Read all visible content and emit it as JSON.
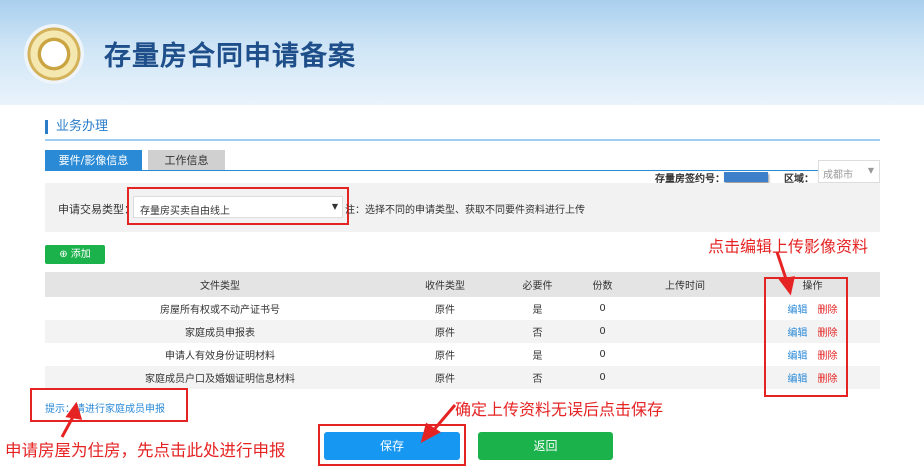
{
  "header": {
    "title": "存量房合同申请备案"
  },
  "section": {
    "title": "业务办理"
  },
  "tabs": [
    {
      "label": "要件/影像信息",
      "active": true
    },
    {
      "label": "工作信息",
      "active": false
    }
  ],
  "contract": {
    "label": "存量房签约号：",
    "region_label": "区域：",
    "region_value": "成都市"
  },
  "filter": {
    "label": "申请交易类型：",
    "value": "存量房买卖自由线上",
    "note": "注：选择不同的申请类型、获取不同要件资料进行上传"
  },
  "add_button": "添加",
  "table": {
    "headers": [
      "文件类型",
      "收件类型",
      "必要件",
      "份数",
      "上传时间",
      "操作"
    ],
    "rows": [
      {
        "type": "房屋所有权或不动产证书号",
        "receive": "原件",
        "required": "是",
        "count": "0",
        "time": ""
      },
      {
        "type": "家庭成员申报表",
        "receive": "原件",
        "required": "否",
        "count": "0",
        "time": ""
      },
      {
        "type": "申请人有效身份证明材料",
        "receive": "原件",
        "required": "是",
        "count": "0",
        "time": ""
      },
      {
        "type": "家庭成员户口及婚姻证明信息材料",
        "receive": "原件",
        "required": "否",
        "count": "0",
        "time": ""
      }
    ],
    "edit": "编辑",
    "delete": "删除"
  },
  "hint": {
    "prefix": "提示：",
    "link": "请进行家庭成员申报"
  },
  "buttons": {
    "save": "保存",
    "back": "返回"
  },
  "annotations": {
    "edit": "点击编辑上传影像资料",
    "save": "确定上传资料无误后点击保存",
    "hint": "申请房屋为住房，先点击此处进行申报"
  }
}
